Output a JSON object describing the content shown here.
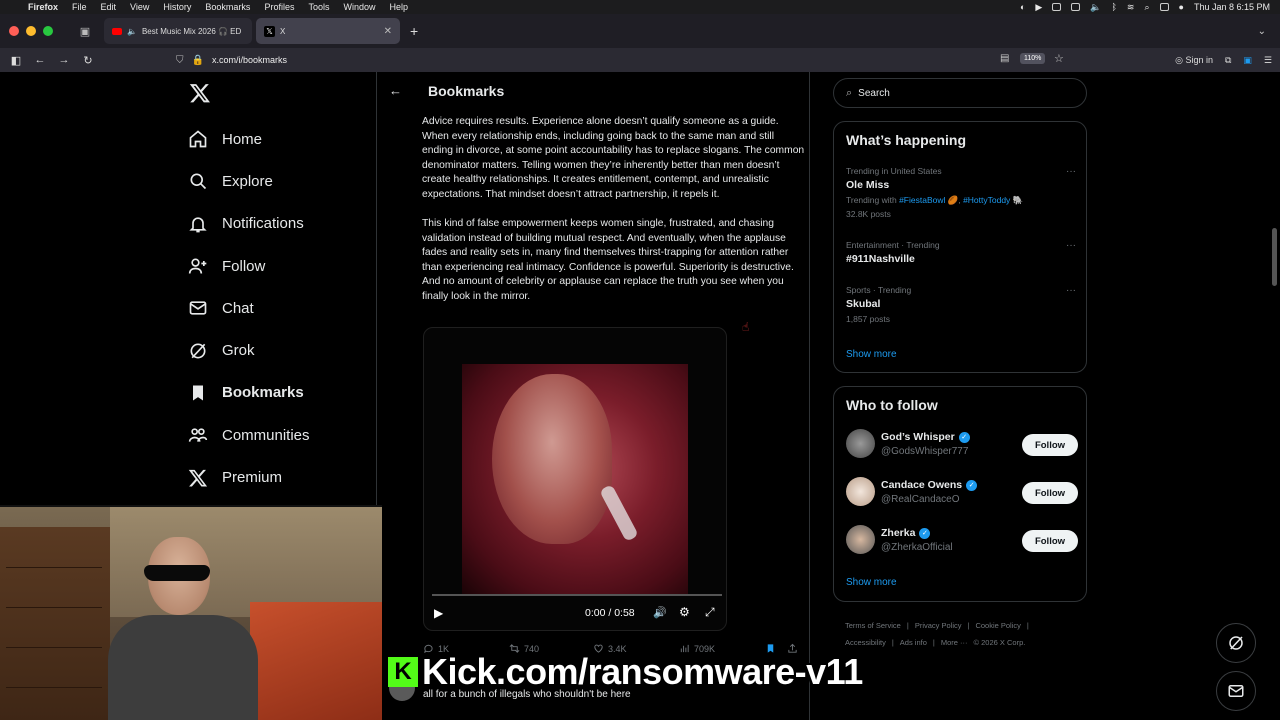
{
  "menubar": {
    "app": "Firefox",
    "items": [
      "File",
      "Edit",
      "View",
      "History",
      "Bookmarks",
      "Profiles",
      "Tools",
      "Window",
      "Help"
    ],
    "clock": "Thu Jan 8  6:15 PM"
  },
  "tabs": [
    {
      "title": "Best Music Mix 2026 🎧 ED"
    },
    {
      "title": "X"
    }
  ],
  "navbar": {
    "url": "x.com/i/bookmarks",
    "zoom": "110%",
    "sign_in": "Sign in"
  },
  "sidebar": {
    "items": [
      {
        "label": "Home",
        "icon": "home-icon"
      },
      {
        "label": "Explore",
        "icon": "search-icon"
      },
      {
        "label": "Notifications",
        "icon": "bell-icon"
      },
      {
        "label": "Follow",
        "icon": "person-add-icon"
      },
      {
        "label": "Chat",
        "icon": "mail-icon"
      },
      {
        "label": "Grok",
        "icon": "grok-icon"
      },
      {
        "label": "Bookmarks",
        "icon": "bookmark-icon"
      },
      {
        "label": "Communities",
        "icon": "people-icon"
      },
      {
        "label": "Premium",
        "icon": "x-logo-icon"
      }
    ]
  },
  "main": {
    "title": "Bookmarks",
    "post": {
      "paragraphs": [
        "Advice requires results. Experience alone doesn’t qualify someone as a guide. When every relationship ends, including going back to the same man and still ending in divorce, at some point accountability has to replace slogans. The common denominator matters. Telling women they’re inherently better than men doesn’t create healthy relationships. It creates entitlement, contempt, and unrealistic expectations. That mindset doesn’t attract partnership, it repels it.",
        "This kind of false empowerment keeps women single, frustrated, and chasing validation instead of building mutual respect. And eventually, when the applause fades and reality sets in, many find themselves thirst-trapping for attention rather than experiencing real intimacy. Confidence is powerful. Superiority is destructive. And no amount of celebrity or applause can replace the truth you see when you finally look in the mirror."
      ],
      "video": {
        "time": "0:00 / 0:58",
        "progress": 0
      },
      "stats": {
        "replies": "1K",
        "reposts": "740",
        "likes": "3.4K",
        "views": "709K"
      }
    },
    "next_post": {
      "text": "all for a bunch of illegals who shouldn't be here"
    }
  },
  "right": {
    "search_placeholder": "Search",
    "whats_happening": {
      "title": "What’s happening",
      "trends": [
        {
          "meta": "Trending in United States",
          "name": "Ole Miss",
          "sub_prefix": "Trending with ",
          "tags": [
            "#FiestaBowl 🏉",
            "#HottyToddy 🐘"
          ],
          "posts": "32.8K posts"
        },
        {
          "meta": "Entertainment · Trending",
          "name": "#911Nashville",
          "posts": ""
        },
        {
          "meta": "Sports · Trending",
          "name": "Skubal",
          "posts": "1,857 posts"
        }
      ],
      "show_more": "Show more"
    },
    "who_to_follow": {
      "title": "Who to follow",
      "users": [
        {
          "name": "God’s Whisper",
          "handle": "@GodsWhisper777",
          "button": "Follow"
        },
        {
          "name": "Candace Owens",
          "handle": "@RealCandaceO",
          "button": "Follow"
        },
        {
          "name": "Zherka",
          "handle": "@ZherkaOfficial",
          "button": "Follow"
        }
      ],
      "show_more": "Show more"
    },
    "footer": {
      "links": [
        "Terms of Service",
        "|",
        "Privacy Policy",
        "|",
        "Cookie Policy",
        "|",
        "Accessibility",
        "|",
        "Ads info",
        "|",
        "More ···",
        "© 2026 X Corp."
      ]
    }
  },
  "overlay": {
    "kick_text": "Kick.com/ransomware-v11"
  },
  "colors": {
    "accent": "#1d9bf0",
    "background": "#000000",
    "kick_green": "#53fc18"
  }
}
